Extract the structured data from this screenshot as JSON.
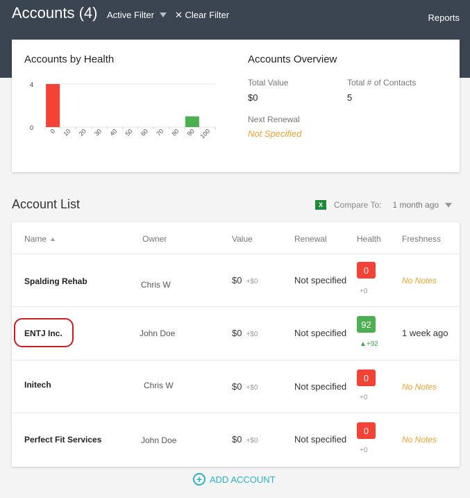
{
  "header": {
    "title": "Accounts (4)",
    "filter_label": "Active Filter",
    "clear_filter_label": "Clear Filter",
    "reports_label": "Reports"
  },
  "health_card": {
    "title": "Accounts by Health"
  },
  "chart_data": {
    "type": "bar",
    "title": "Accounts by Health",
    "categories": [
      "0",
      "10",
      "20",
      "30",
      "40",
      "50",
      "60",
      "70",
      "80",
      "90",
      "100"
    ],
    "values": [
      4,
      0,
      0,
      0,
      0,
      0,
      0,
      0,
      0,
      1,
      0
    ],
    "bar_colors": [
      "#f44336",
      "",
      "",
      "",
      "",
      "",
      "",
      "",
      "",
      "#4caf50",
      ""
    ],
    "y_ticks": [
      "4",
      "0"
    ],
    "ylim": [
      0,
      4
    ],
    "grid": true
  },
  "overview": {
    "title": "Accounts Overview",
    "total_value_label": "Total Value",
    "total_value": "$0",
    "contacts_label": "Total # of Contacts",
    "contacts_value": "5",
    "next_renewal_label": "Next Renewal",
    "next_renewal_value": "Not Specified"
  },
  "list": {
    "title": "Account List",
    "excel_icon_text": "X",
    "compare_label": "Compare To:",
    "compare_value": "1 month ago",
    "columns": [
      "Name",
      "Owner",
      "Value",
      "Renewal",
      "Health",
      "Freshness"
    ],
    "rows": [
      {
        "name": "Spalding Rehab",
        "owner": "Chris W",
        "value": "$0",
        "value_delta": "+$0",
        "renewal": "Not specified",
        "health": "0",
        "health_delta": "+0",
        "freshness": "No Notes"
      },
      {
        "name": "ENTJ Inc.",
        "owner": "John Doe",
        "value": "$0",
        "value_delta": "+$0",
        "renewal": "Not specified",
        "health": "92",
        "health_delta": "+92",
        "freshness": "1 week ago"
      },
      {
        "name": "Initech",
        "owner": "Chris W",
        "value": "$0",
        "value_delta": "+$0",
        "renewal": "Not specified",
        "health": "0",
        "health_delta": "+0",
        "freshness": "No Notes"
      },
      {
        "name": "Perfect Fit Services",
        "owner": "John Doe",
        "value": "$0",
        "value_delta": "+$0",
        "renewal": "Not specified",
        "health": "0",
        "health_delta": "+0",
        "freshness": "No Notes"
      }
    ],
    "add_label": "ADD ACCOUNT"
  },
  "colors": {
    "header_bg": "#3b4552",
    "health_bad": "#f44336",
    "health_good": "#4caf50",
    "warning_text": "#f0a030",
    "accent": "#2ab1c7",
    "annotation": "#d01820"
  }
}
